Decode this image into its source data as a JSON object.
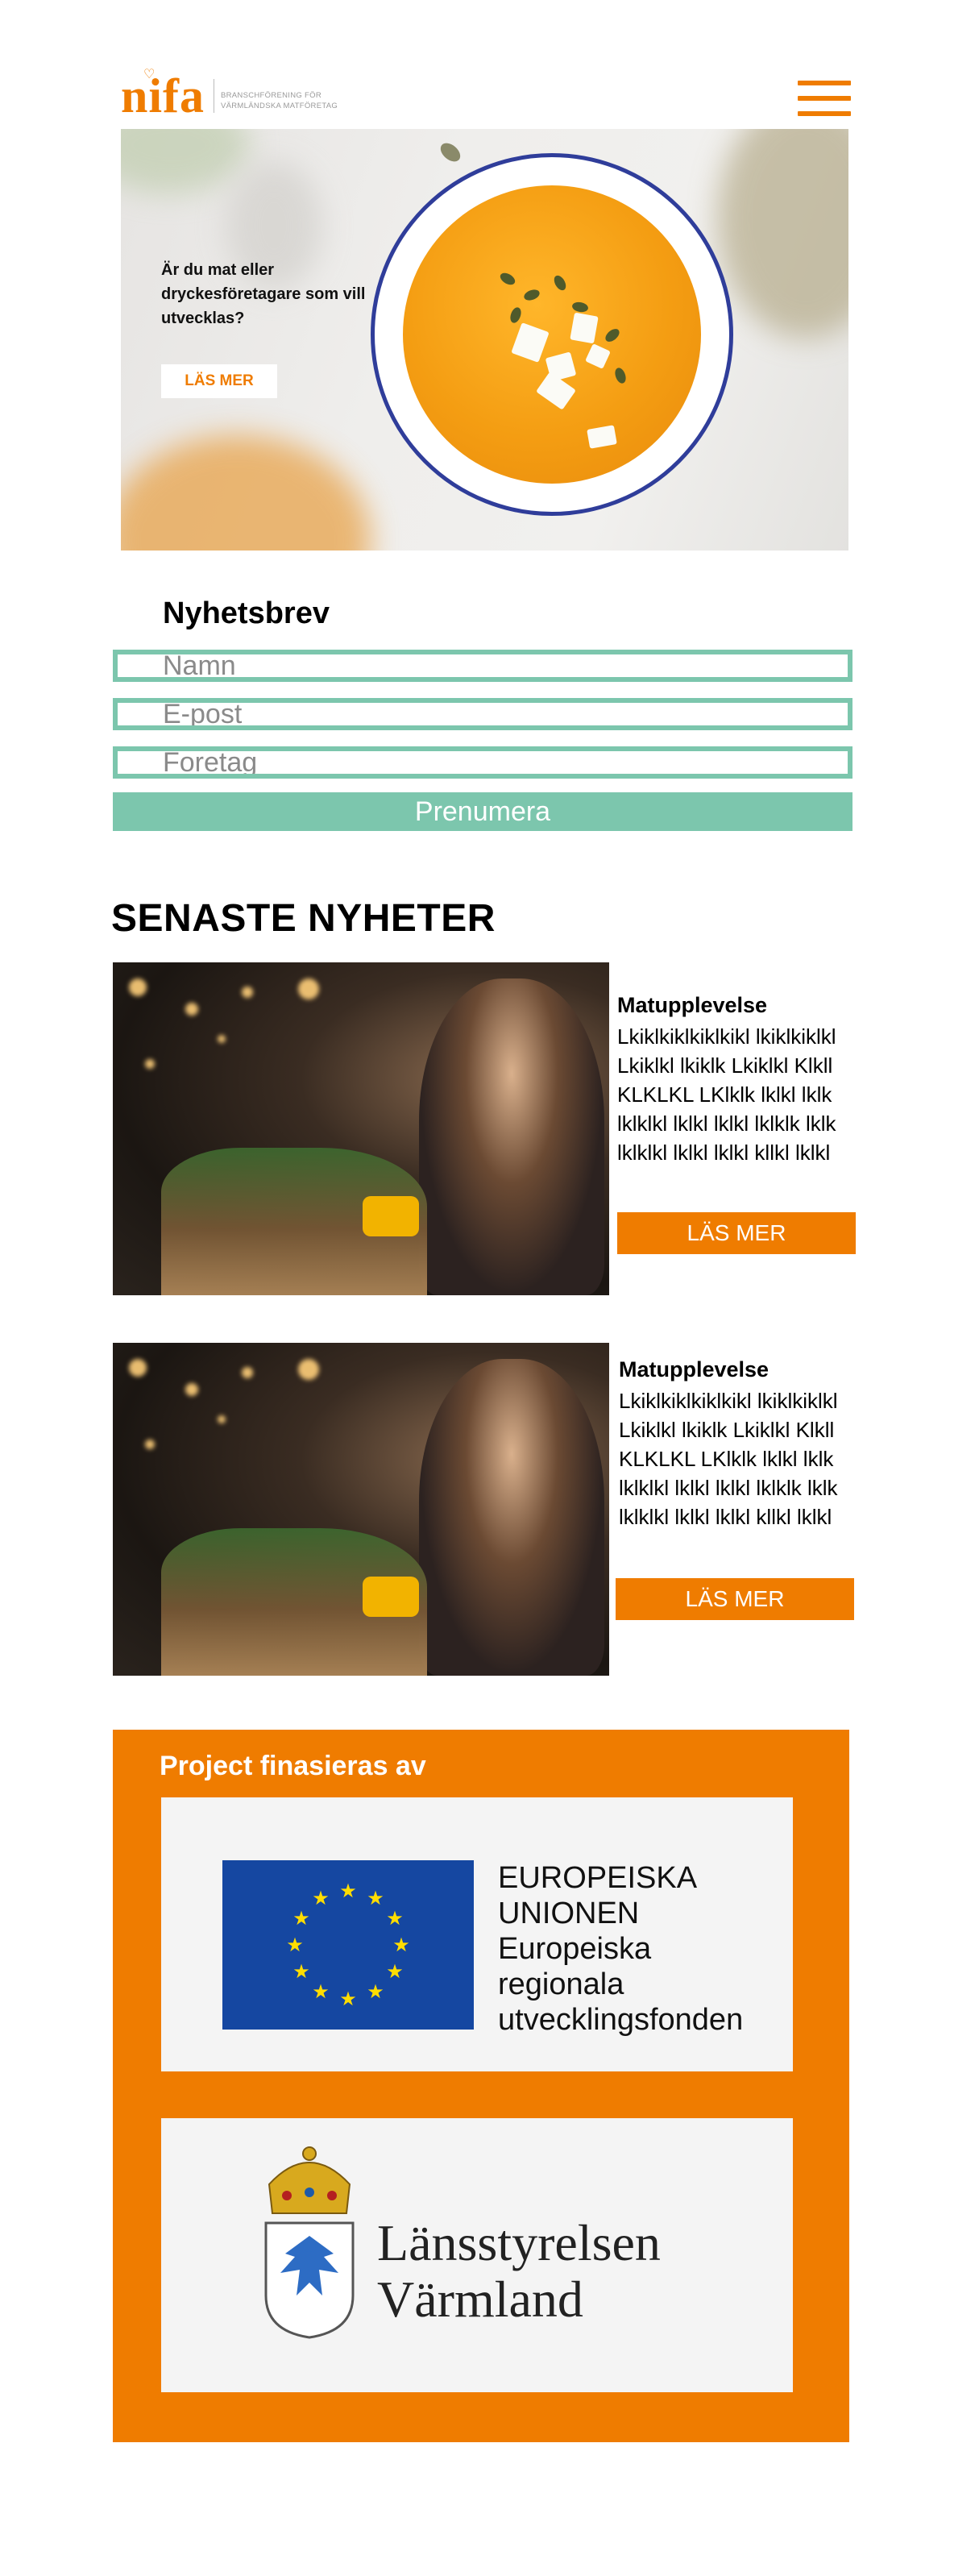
{
  "header": {
    "logo_text": "nifa",
    "logo_tagline_1": "BRANSCHFÖRENING FÖR",
    "logo_tagline_2": "VÄRMLÄNDSKA MATFÖRETAG",
    "menu_icon": "hamburger-menu-icon"
  },
  "hero": {
    "text": "Är du mat eller dryckesföretagare som vill utvecklas?",
    "button": "LÄS MER"
  },
  "newsletter": {
    "title": "Nyhetsbrev",
    "name_placeholder": "Namn",
    "email_placeholder": "E-post",
    "company_placeholder": "Foretag",
    "submit": "Prenumera"
  },
  "news": {
    "heading": "SENASTE NYHETER",
    "items": [
      {
        "title": "Matupplevelse",
        "body": "Lkiklkiklkiklkikl lkiklkiklkl Lkiklkl lkiklk Lkiklkl Klkll KLKLKL LKlklk lklkl lklk lklklkl lklkl lklkl lklklk lklk lklklkl lklkl lklkl kllkl lklkl",
        "button": "LÄS MER"
      },
      {
        "title": "Matupplevelse",
        "body": "Lkiklkiklkiklkikl lkiklkiklkl Lkiklkl lkiklk Lkiklkl Klkll KLKLKL LKlklk lklkl lklk lklklkl lklkl lklkl lklklk lklk lklklkl lklkl lklkl kllkl lklkl",
        "button": "LÄS MER"
      }
    ]
  },
  "funding": {
    "title": "Project finasieras av",
    "eu_line1": "EUROPEISKA",
    "eu_line2": "UNIONEN",
    "eu_line3": "Europeiska",
    "eu_line4": "regionala",
    "eu_line5": "utvecklingsfonden",
    "lans_line1": "Länsstyrelsen",
    "lans_line2": "Värmland"
  },
  "colors": {
    "brand_orange": "#ef7c00",
    "mint": "#7cc6ad",
    "eu_blue": "#1547a1",
    "eu_star": "#ffdd00"
  }
}
